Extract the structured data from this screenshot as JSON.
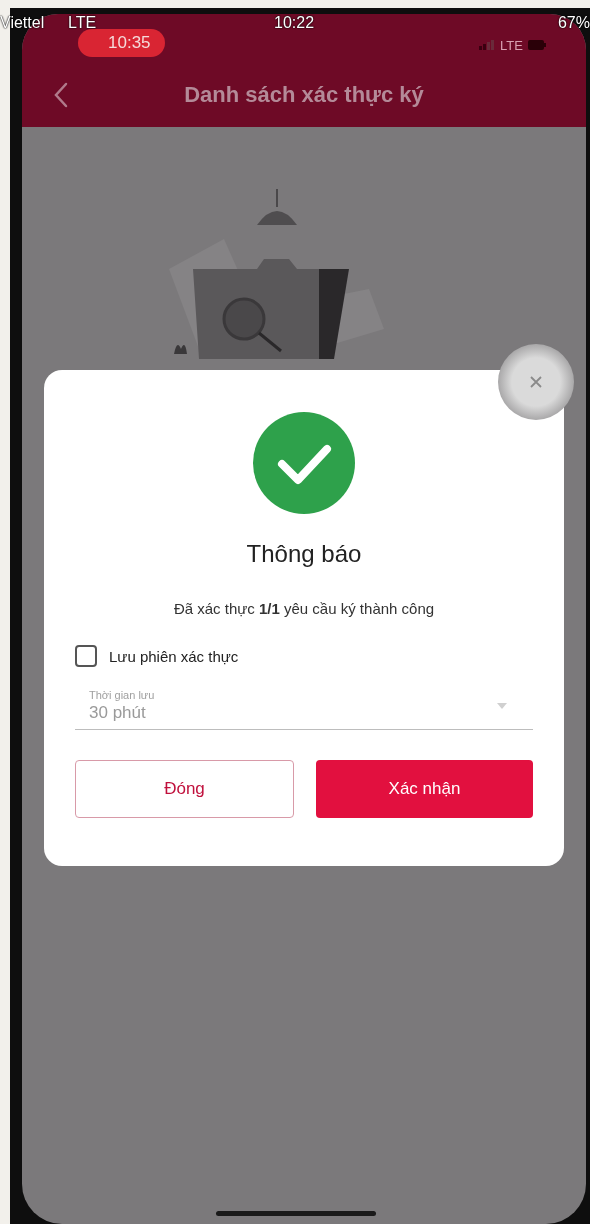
{
  "recording_status_bar": {
    "carrier": "Viettel",
    "network": "LTE",
    "time": "10:22",
    "battery": "67%"
  },
  "status_bar": {
    "time": "10:35",
    "network": "LTE"
  },
  "header": {
    "title": "Danh sách xác thực ký"
  },
  "dialog": {
    "title": "Thông báo",
    "message": "Đã xác thực **1/1** yêu cầu ký thành công",
    "save_session": {
      "label": "Lưu phiên xác thực",
      "checked": false
    },
    "duration_field": {
      "label": "Thời gian lưu",
      "value": "30 phút"
    },
    "buttons": [
      {
        "label": "Đóng",
        "kind": "secondary"
      },
      {
        "label": "Xác nhận",
        "kind": "primary"
      }
    ]
  }
}
